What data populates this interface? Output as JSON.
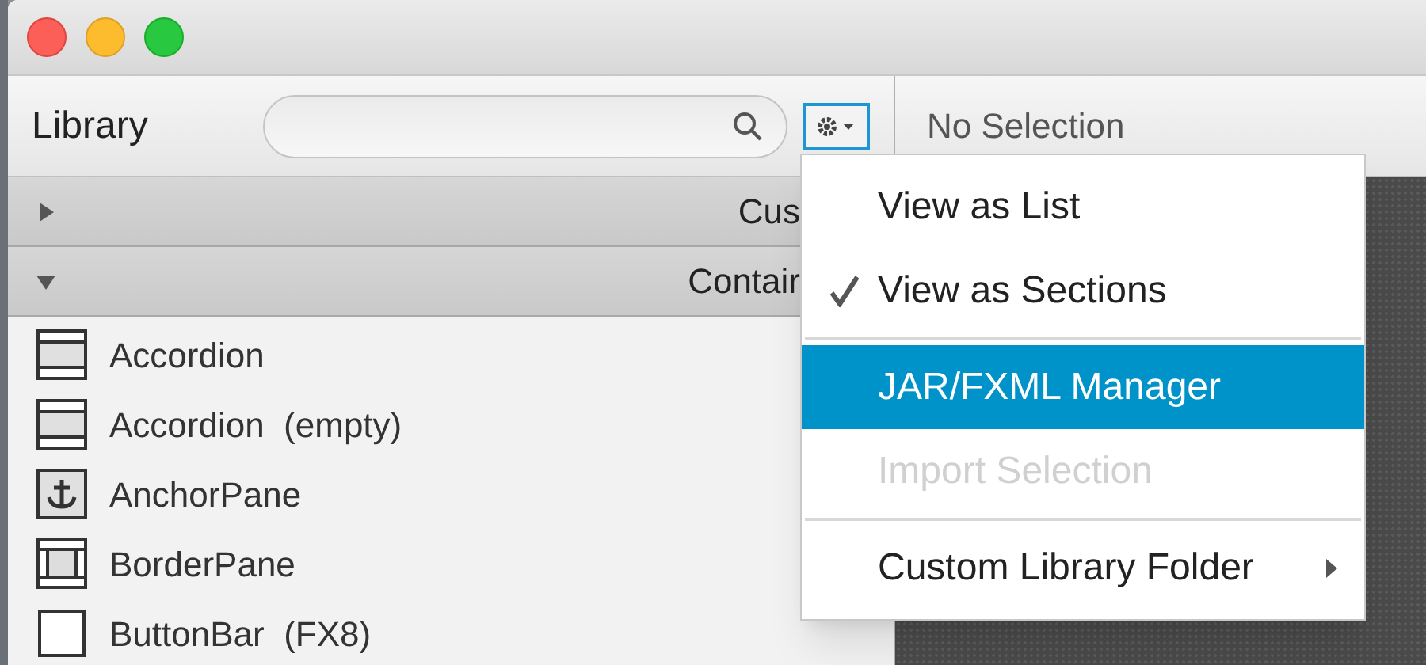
{
  "library": {
    "title": "Library",
    "sections": [
      {
        "label": "Cus",
        "expanded": false
      },
      {
        "label": "Contair",
        "expanded": true
      }
    ],
    "items": [
      {
        "label": "Accordion",
        "kind": "accordion"
      },
      {
        "label": "Accordion  (empty)",
        "kind": "accordion"
      },
      {
        "label": "AnchorPane",
        "kind": "anchor"
      },
      {
        "label": "BorderPane",
        "kind": "border"
      },
      {
        "label": "ButtonBar  (FX8)",
        "kind": "plain"
      }
    ]
  },
  "inspector": {
    "title": "No Selection"
  },
  "menu": [
    {
      "kind": "item",
      "label": "View as List",
      "checked": false,
      "selected": false,
      "disabled": false,
      "submenu": false
    },
    {
      "kind": "item",
      "label": "View as Sections",
      "checked": true,
      "selected": false,
      "disabled": false,
      "submenu": false
    },
    {
      "kind": "separator"
    },
    {
      "kind": "item",
      "label": "JAR/FXML Manager",
      "checked": false,
      "selected": true,
      "disabled": false,
      "submenu": false
    },
    {
      "kind": "item",
      "label": "Import Selection",
      "checked": false,
      "selected": false,
      "disabled": true,
      "submenu": false
    },
    {
      "kind": "separator"
    },
    {
      "kind": "item",
      "label": "Custom Library Folder",
      "checked": false,
      "selected": false,
      "disabled": false,
      "submenu": true
    }
  ]
}
